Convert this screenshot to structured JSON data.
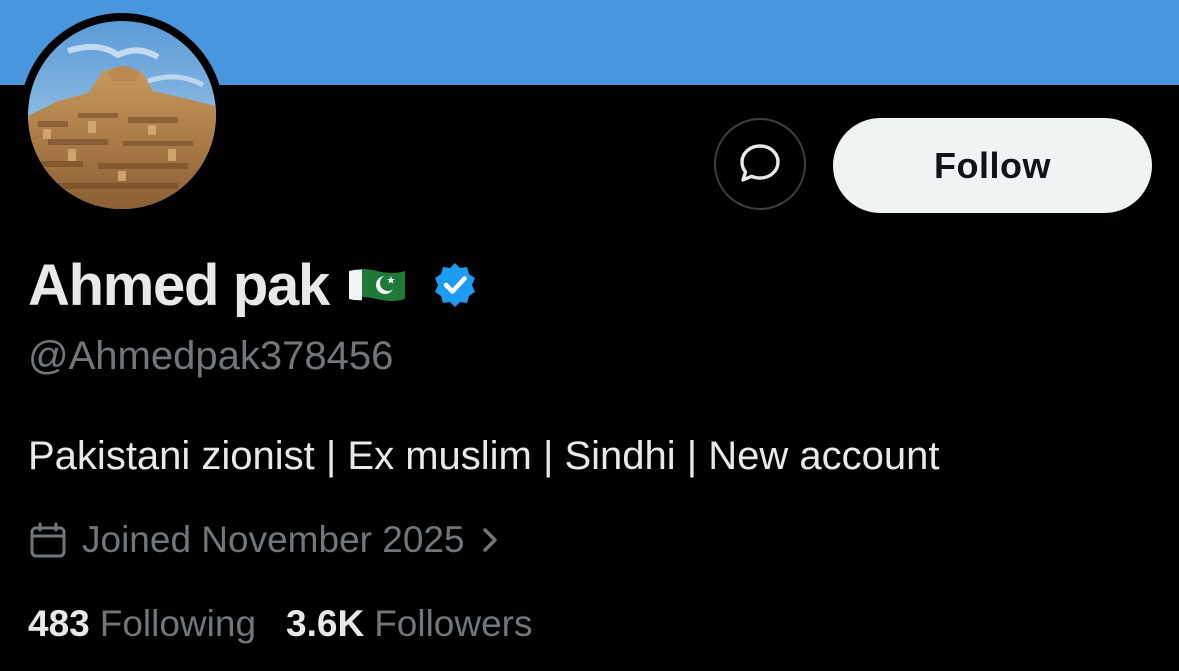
{
  "banner": {
    "color": "#4a96de"
  },
  "profile": {
    "display_name": "Ahmed pak",
    "flag_icon": "pakistan-flag-emoji",
    "verified_icon": "verified-badge-icon",
    "verified_color": "#1d9bf0",
    "handle": "@Ahmedpak378456",
    "bio": "Pakistani zionist | Ex muslim | Sindhi | New account",
    "joined": "Joined November 2025"
  },
  "actions": {
    "message_icon": "message-bubble-icon",
    "follow_label": "Follow"
  },
  "stats": {
    "following_count": "483",
    "following_label": "Following",
    "followers_count": "3.6K",
    "followers_label": "Followers"
  }
}
